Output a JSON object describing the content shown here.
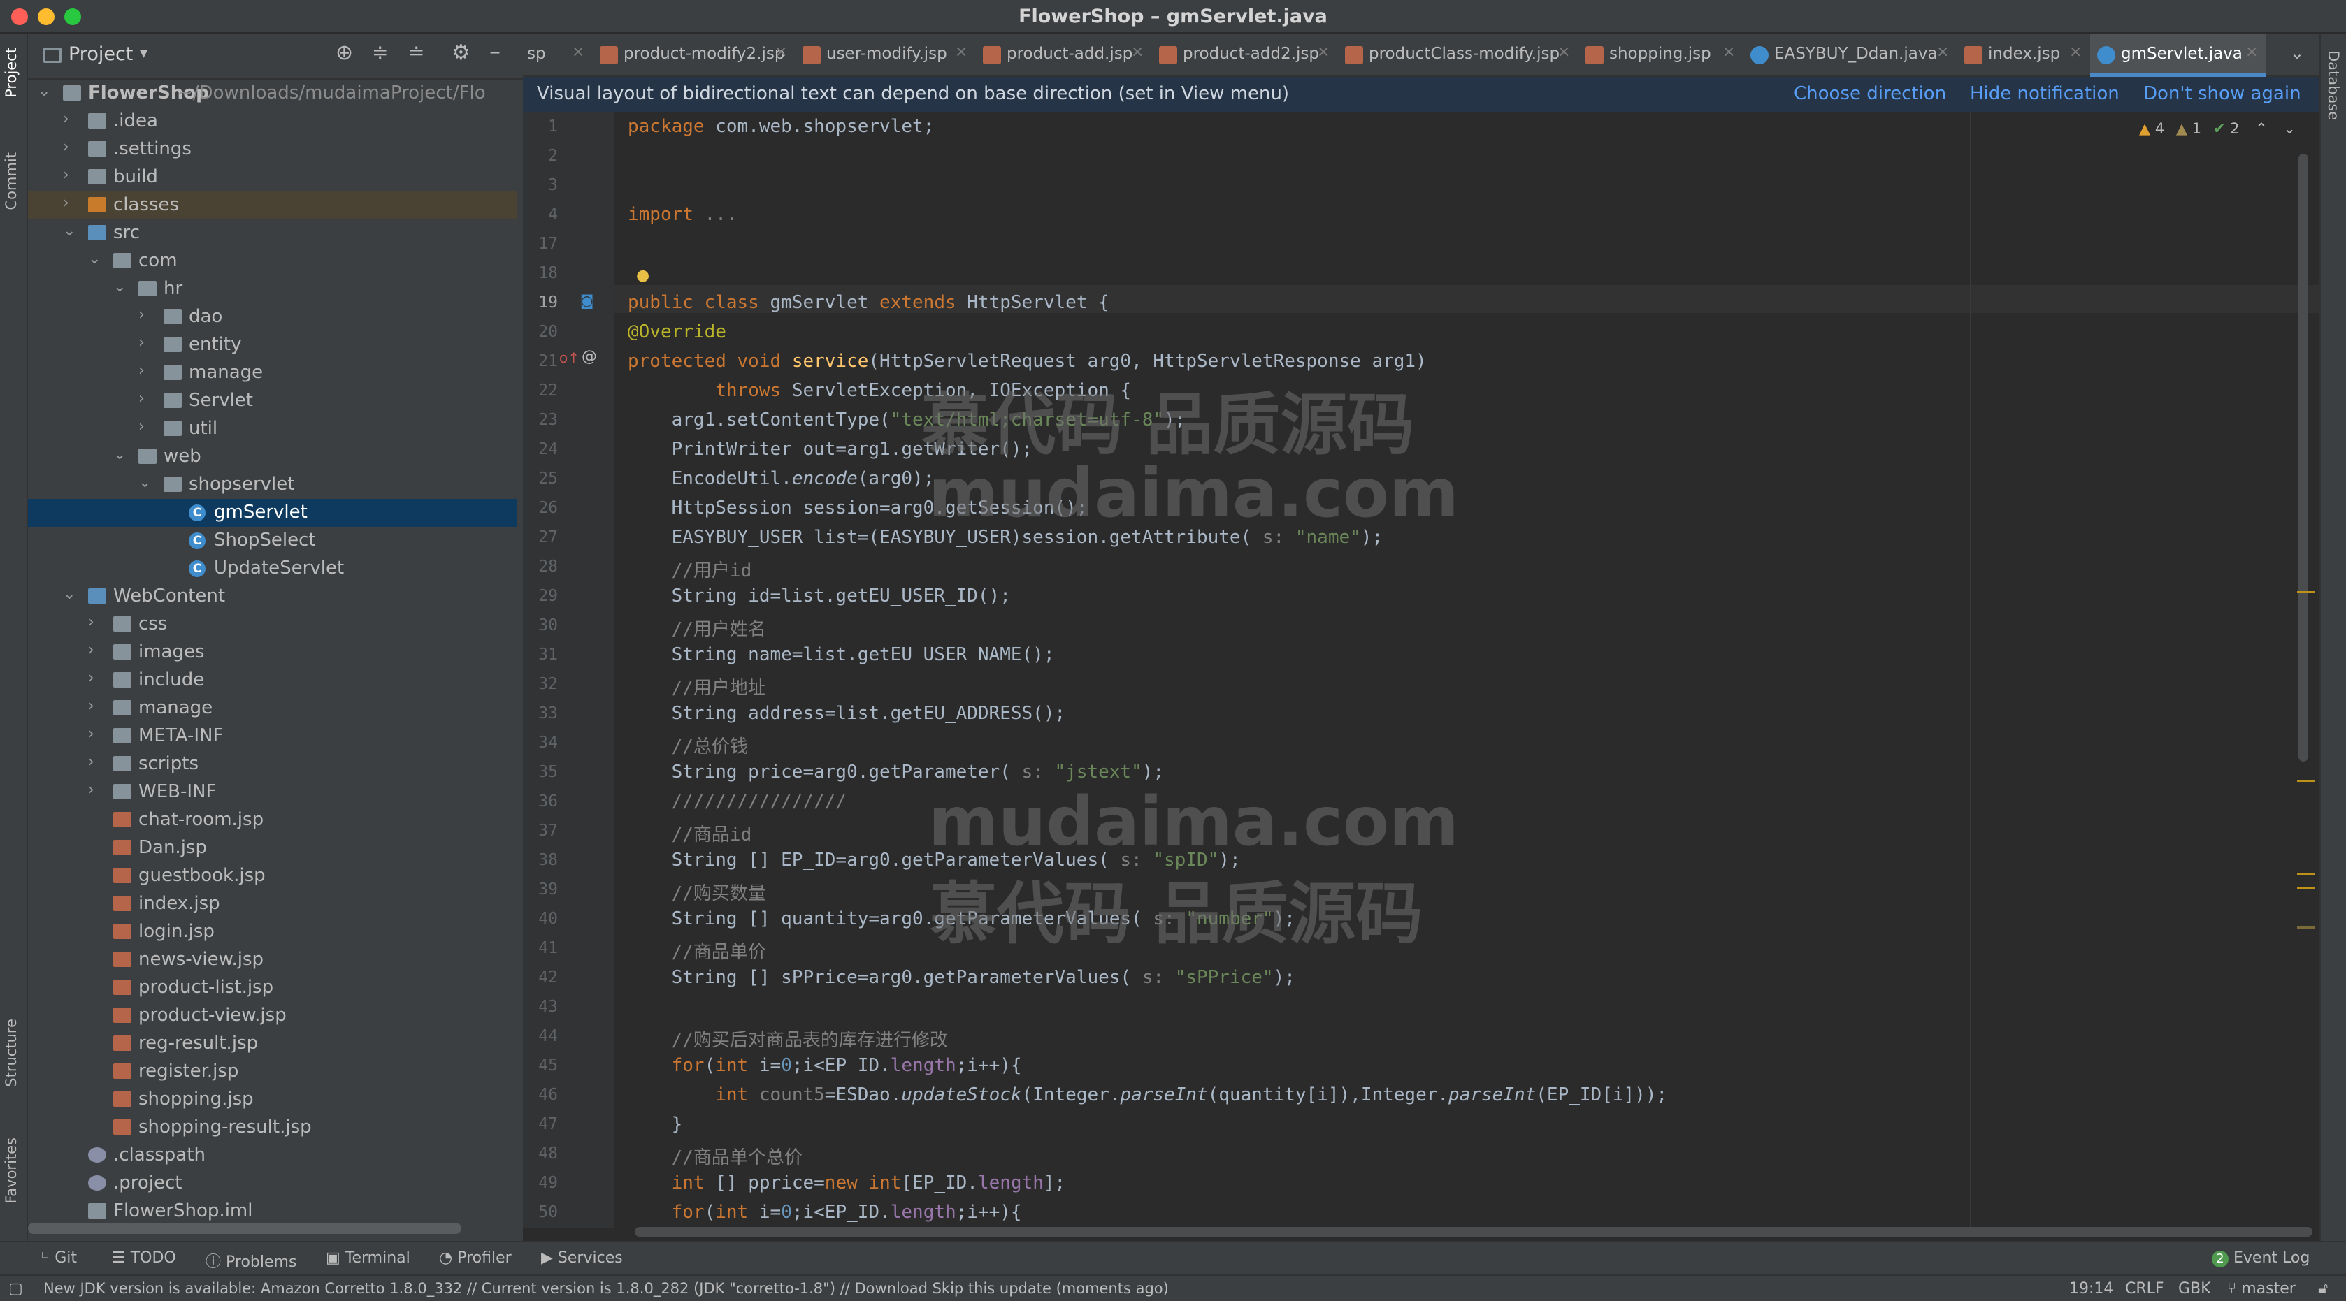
{
  "window": {
    "title": "FlowerShop – gmServlet.java"
  },
  "sidebar_left": {
    "project_tab": "Project",
    "commit_tab": "Commit",
    "structure_tab": "Structure",
    "favorites_tab": "Favorites"
  },
  "sidebar_right": {
    "database_tab": "Database"
  },
  "project_panel": {
    "title": "Project",
    "tree": [
      {
        "label": "FlowerShop",
        "extra": "~/Downloads/mudaimaProject/Flo",
        "depth": 0,
        "kind": "module",
        "open": true
      },
      {
        "label": ".idea",
        "depth": 1,
        "kind": "folder",
        "open": false
      },
      {
        "label": ".settings",
        "depth": 1,
        "kind": "folder",
        "open": false
      },
      {
        "label": "build",
        "depth": 1,
        "kind": "folder",
        "open": false
      },
      {
        "label": "classes",
        "depth": 1,
        "kind": "folder-orange",
        "open": false,
        "highlight": true
      },
      {
        "label": "src",
        "depth": 1,
        "kind": "folder-src",
        "open": true
      },
      {
        "label": "com",
        "depth": 2,
        "kind": "package",
        "open": true
      },
      {
        "label": "hr",
        "depth": 3,
        "kind": "package",
        "open": true
      },
      {
        "label": "dao",
        "depth": 4,
        "kind": "package",
        "open": false
      },
      {
        "label": "entity",
        "depth": 4,
        "kind": "package",
        "open": false
      },
      {
        "label": "manage",
        "depth": 4,
        "kind": "package",
        "open": false
      },
      {
        "label": "Servlet",
        "depth": 4,
        "kind": "package",
        "open": false
      },
      {
        "label": "util",
        "depth": 4,
        "kind": "package",
        "open": false
      },
      {
        "label": "web",
        "depth": 3,
        "kind": "package",
        "open": true
      },
      {
        "label": "shopservlet",
        "depth": 4,
        "kind": "package",
        "open": true
      },
      {
        "label": "gmServlet",
        "depth": 5,
        "kind": "class",
        "selected": true
      },
      {
        "label": "ShopSelect",
        "depth": 5,
        "kind": "class"
      },
      {
        "label": "UpdateServlet",
        "depth": 5,
        "kind": "class"
      },
      {
        "label": "WebContent",
        "depth": 1,
        "kind": "folder-web",
        "open": true
      },
      {
        "label": "css",
        "depth": 2,
        "kind": "folder",
        "open": false
      },
      {
        "label": "images",
        "depth": 2,
        "kind": "folder",
        "open": false
      },
      {
        "label": "include",
        "depth": 2,
        "kind": "folder",
        "open": false
      },
      {
        "label": "manage",
        "depth": 2,
        "kind": "folder",
        "open": false
      },
      {
        "label": "META-INF",
        "depth": 2,
        "kind": "folder",
        "open": false
      },
      {
        "label": "scripts",
        "depth": 2,
        "kind": "folder",
        "open": false
      },
      {
        "label": "WEB-INF",
        "depth": 2,
        "kind": "folder",
        "open": false
      },
      {
        "label": "chat-room.jsp",
        "depth": 2,
        "kind": "jsp"
      },
      {
        "label": "Dan.jsp",
        "depth": 2,
        "kind": "jsp"
      },
      {
        "label": "guestbook.jsp",
        "depth": 2,
        "kind": "jsp"
      },
      {
        "label": "index.jsp",
        "depth": 2,
        "kind": "jsp"
      },
      {
        "label": "login.jsp",
        "depth": 2,
        "kind": "jsp"
      },
      {
        "label": "news-view.jsp",
        "depth": 2,
        "kind": "jsp"
      },
      {
        "label": "product-list.jsp",
        "depth": 2,
        "kind": "jsp"
      },
      {
        "label": "product-view.jsp",
        "depth": 2,
        "kind": "jsp"
      },
      {
        "label": "reg-result.jsp",
        "depth": 2,
        "kind": "jsp"
      },
      {
        "label": "register.jsp",
        "depth": 2,
        "kind": "jsp"
      },
      {
        "label": "shopping.jsp",
        "depth": 2,
        "kind": "jsp"
      },
      {
        "label": "shopping-result.jsp",
        "depth": 2,
        "kind": "jsp"
      },
      {
        "label": ".classpath",
        "depth": 1,
        "kind": "dotfile"
      },
      {
        "label": ".project",
        "depth": 1,
        "kind": "dotfile"
      },
      {
        "label": "FlowerShop.iml",
        "depth": 1,
        "kind": "iml"
      }
    ]
  },
  "tabs": [
    {
      "label": "sp",
      "icon": "none"
    },
    {
      "label": "product-modify2.jsp",
      "icon": "jsp"
    },
    {
      "label": "user-modify.jsp",
      "icon": "jsp"
    },
    {
      "label": "product-add.jsp",
      "icon": "jsp"
    },
    {
      "label": "product-add2.jsp",
      "icon": "jsp"
    },
    {
      "label": "productClass-modify.jsp",
      "icon": "jsp"
    },
    {
      "label": "shopping.jsp",
      "icon": "jsp"
    },
    {
      "label": "EASYBUY_Ddan.java",
      "icon": "class"
    },
    {
      "label": "index.jsp",
      "icon": "jsp"
    },
    {
      "label": "gmServlet.java",
      "icon": "class",
      "active": true
    }
  ],
  "notification": {
    "message": "Visual layout of bidirectional text can depend on base direction (set in View menu)",
    "choose": "Choose direction",
    "hide": "Hide notification",
    "dont_show": "Don't show again"
  },
  "inspections": {
    "warnings": "4",
    "weak": "1",
    "ok": "2"
  },
  "watermarks": [
    "慕代码 品质源码",
    "mudaima.com",
    "mudaima.com",
    "慕代码 品质源码"
  ],
  "code_lines": [
    {
      "n": "1",
      "t": [
        [
          "kw",
          "package "
        ],
        [
          "",
          "com.web.shopservlet;"
        ]
      ]
    },
    {
      "n": "2",
      "t": []
    },
    {
      "n": "3",
      "t": []
    },
    {
      "n": "4",
      "t": [
        [
          "kw",
          "import "
        ],
        [
          "cm",
          "..."
        ]
      ]
    },
    {
      "n": "17",
      "t": []
    },
    {
      "n": "18",
      "t": []
    },
    {
      "n": "19",
      "t": [
        [
          "kw",
          "public class "
        ],
        [
          "",
          "gmServlet "
        ],
        [
          "kw",
          "extends "
        ],
        [
          "",
          "HttpServlet {"
        ]
      ]
    },
    {
      "n": "20",
      "t": [
        [
          "an",
          "@Override"
        ]
      ]
    },
    {
      "n": "21",
      "t": [
        [
          "kw",
          "protected void "
        ],
        [
          "fn",
          "service"
        ],
        [
          "",
          "(HttpServletRequest arg0, HttpServletResponse arg1)"
        ]
      ]
    },
    {
      "n": "22",
      "t": [
        [
          "",
          "        "
        ],
        [
          "kw",
          "throws "
        ],
        [
          "",
          "ServletException, IOException {"
        ]
      ]
    },
    {
      "n": "23",
      "t": [
        [
          "",
          "    arg1.setContentType("
        ],
        [
          "str",
          "\"text/html;charset=utf-8\""
        ],
        [
          "",
          ");"
        ]
      ]
    },
    {
      "n": "24",
      "t": [
        [
          "",
          "    PrintWriter out=arg1.getWriter();"
        ]
      ]
    },
    {
      "n": "25",
      "t": [
        [
          "",
          "    EncodeUtil."
        ],
        [
          "it",
          "encode"
        ],
        [
          "",
          "(arg0);"
        ]
      ]
    },
    {
      "n": "26",
      "t": [
        [
          "",
          "    HttpSession session=arg0.getSession();"
        ]
      ]
    },
    {
      "n": "27",
      "t": [
        [
          "",
          "    EASYBUY_USER list=(EASYBUY_USER)session.getAttribute( "
        ],
        [
          "cm",
          "s: "
        ],
        [
          "str",
          "\"name\""
        ],
        [
          "",
          ");"
        ]
      ]
    },
    {
      "n": "28",
      "t": [
        [
          "cm",
          "    //用户id"
        ]
      ]
    },
    {
      "n": "29",
      "t": [
        [
          "",
          "    String id=list.getEU_USER_ID();"
        ]
      ]
    },
    {
      "n": "30",
      "t": [
        [
          "cm",
          "    //用户姓名"
        ]
      ]
    },
    {
      "n": "31",
      "t": [
        [
          "",
          "    String name=list.getEU_USER_NAME();"
        ]
      ]
    },
    {
      "n": "32",
      "t": [
        [
          "cm",
          "    //用户地址"
        ]
      ]
    },
    {
      "n": "33",
      "t": [
        [
          "",
          "    String address=list.getEU_ADDRESS();"
        ]
      ]
    },
    {
      "n": "34",
      "t": [
        [
          "cm",
          "    //总价钱"
        ]
      ]
    },
    {
      "n": "35",
      "t": [
        [
          "",
          "    String price=arg0.getParameter( "
        ],
        [
          "cm",
          "s: "
        ],
        [
          "str",
          "\"jstext\""
        ],
        [
          "",
          ");"
        ]
      ]
    },
    {
      "n": "36",
      "t": [
        [
          "cm",
          "    ////////////////"
        ]
      ]
    },
    {
      "n": "37",
      "t": [
        [
          "cm",
          "    //商品id"
        ]
      ]
    },
    {
      "n": "38",
      "t": [
        [
          "",
          "    String [] EP_ID=arg0.getParameterValues( "
        ],
        [
          "cm",
          "s: "
        ],
        [
          "str",
          "\"spID\""
        ],
        [
          "",
          ");"
        ]
      ]
    },
    {
      "n": "39",
      "t": [
        [
          "cm",
          "    //购买数量"
        ]
      ]
    },
    {
      "n": "40",
      "t": [
        [
          "",
          "    String [] quantity=arg0.getParameterValues( "
        ],
        [
          "cm",
          "s: "
        ],
        [
          "str",
          "\"number\""
        ],
        [
          "",
          ");"
        ]
      ]
    },
    {
      "n": "41",
      "t": [
        [
          "cm",
          "    //商品单价"
        ]
      ]
    },
    {
      "n": "42",
      "t": [
        [
          "",
          "    String [] sPPrice=arg0.getParameterValues( "
        ],
        [
          "cm",
          "s: "
        ],
        [
          "str",
          "\"sPPrice\""
        ],
        [
          "",
          ");"
        ]
      ]
    },
    {
      "n": "43",
      "t": []
    },
    {
      "n": "44",
      "t": [
        [
          "cm",
          "    //购买后对商品表的库存进行修改"
        ]
      ]
    },
    {
      "n": "45",
      "t": [
        [
          "",
          "    "
        ],
        [
          "kw",
          "for"
        ],
        [
          "",
          "("
        ],
        [
          "kw",
          "int "
        ],
        [
          "",
          "i="
        ],
        [
          "num",
          "0"
        ],
        [
          "",
          ";i<EP_ID."
        ],
        [
          "fld",
          "length"
        ],
        [
          "",
          ";i++){"
        ]
      ]
    },
    {
      "n": "46",
      "t": [
        [
          "",
          "        "
        ],
        [
          "kw",
          "int "
        ],
        [
          "cm",
          "count5"
        ],
        [
          "",
          "=ESDao."
        ],
        [
          "it",
          "updateStock"
        ],
        [
          "",
          "(Integer."
        ],
        [
          "it",
          "parseInt"
        ],
        [
          "",
          "(quantity[i]),Integer."
        ],
        [
          "it",
          "parseInt"
        ],
        [
          "",
          "(EP_ID[i]));"
        ]
      ]
    },
    {
      "n": "47",
      "t": [
        [
          "",
          "    }"
        ]
      ]
    },
    {
      "n": "48",
      "t": [
        [
          "cm",
          "    //商品单个总价"
        ]
      ]
    },
    {
      "n": "49",
      "t": [
        [
          "",
          "    "
        ],
        [
          "kw",
          "int "
        ],
        [
          "",
          "[] pprice="
        ],
        [
          "kw",
          "new int"
        ],
        [
          "",
          "[EP_ID."
        ],
        [
          "fld",
          "length"
        ],
        [
          "",
          "];"
        ]
      ]
    },
    {
      "n": "50",
      "t": [
        [
          "",
          "    "
        ],
        [
          "kw",
          "for"
        ],
        [
          "",
          "("
        ],
        [
          "kw",
          "int "
        ],
        [
          "",
          "i="
        ],
        [
          "num",
          "0"
        ],
        [
          "",
          ";i<EP_ID."
        ],
        [
          "fld",
          "length"
        ],
        [
          "",
          ";i++){"
        ]
      ]
    }
  ],
  "tool_windows": [
    "Git",
    "TODO",
    "Problems",
    "Terminal",
    "Profiler",
    "Services"
  ],
  "event_log": {
    "count": "2",
    "label": "Event Log"
  },
  "status_bar": {
    "message": "New JDK version is available: Amazon Corretto 1.8.0_332 // Current version is 1.8.0_282 (JDK \"corretto-1.8\") // Download   Skip this update (moments ago)",
    "position": "19:14",
    "line_sep": "CRLF",
    "encoding": "GBK",
    "branch": "master"
  },
  "colors": {
    "accent": "#4a88c7",
    "keyword": "#cc7832",
    "string": "#6a8759",
    "comment": "#808080",
    "annotation": "#bbb529",
    "selection": "#0d3a5e"
  }
}
